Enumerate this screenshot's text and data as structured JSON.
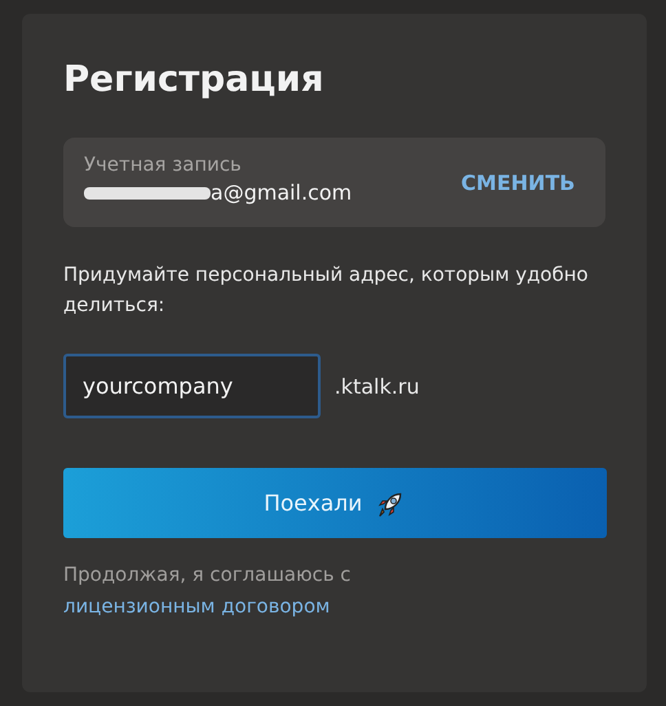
{
  "title": "Регистрация",
  "account": {
    "label": "Учетная запись",
    "email": "a@gmail.com",
    "change_button": "СМЕНИТЬ"
  },
  "prompt": "Придумайте персональный адрес, которым удобно делиться:",
  "address": {
    "value": "yourcompany",
    "suffix": ".ktalk.ru"
  },
  "submit_button": "Поехали",
  "legal": {
    "text": "Продолжая, я соглашаюсь с ",
    "link": "лицензионным договором"
  }
}
